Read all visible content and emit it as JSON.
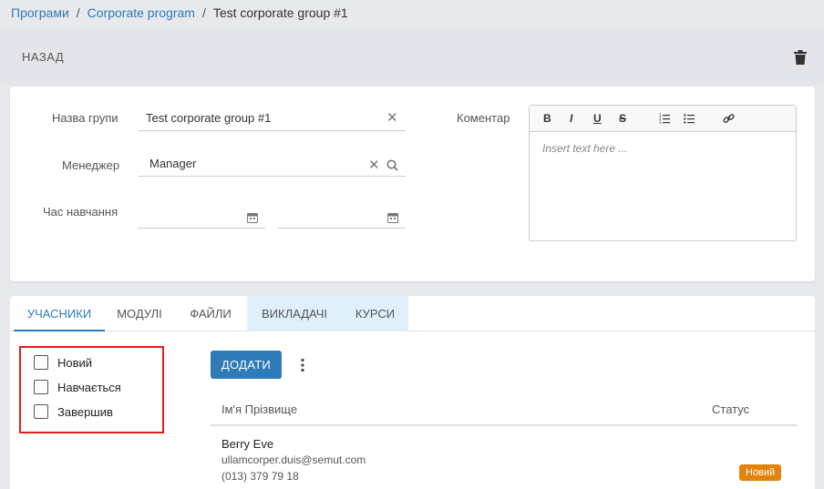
{
  "breadcrumb": {
    "items": [
      "Програми",
      "Corporate program",
      "Test corporate group #1"
    ],
    "separator": "/"
  },
  "header": {
    "back_label": "НАЗАД"
  },
  "form": {
    "group_name_label": "Назва групи",
    "group_name_value": "Test corporate group #1",
    "manager_label": "Менеджер",
    "manager_value": "Manager",
    "study_time_label": "Час навчання",
    "comment_label": "Коментар",
    "comment_placeholder": "Insert text here ..."
  },
  "editor_toolbar": {
    "bold": "B",
    "italic": "I",
    "underline": "U",
    "strike": "S"
  },
  "tabs": [
    {
      "label": "УЧАСНИКИ",
      "active": true
    },
    {
      "label": "МОДУЛІ",
      "active": false
    },
    {
      "label": "ФАЙЛИ",
      "active": false
    },
    {
      "label": "ВИКЛАДАЧІ",
      "active": false
    },
    {
      "label": "КУРСИ",
      "active": false
    }
  ],
  "filters": [
    {
      "label": "Новий",
      "checked": false
    },
    {
      "label": "Навчається",
      "checked": false
    },
    {
      "label": "Завершив",
      "checked": false
    }
  ],
  "actions": {
    "add_label": "ДОДАТИ"
  },
  "table": {
    "columns": [
      "Ім'я Прізвище",
      "Статус"
    ],
    "rows": [
      {
        "name": "Berry Eve",
        "email": "ullamcorper.duis@semut.com",
        "phone": "(013) 379 79 18",
        "status": "Новий"
      }
    ]
  },
  "colors": {
    "accent": "#2f7bb8",
    "status_new": "#e3820c",
    "highlight": "#e0201a"
  }
}
